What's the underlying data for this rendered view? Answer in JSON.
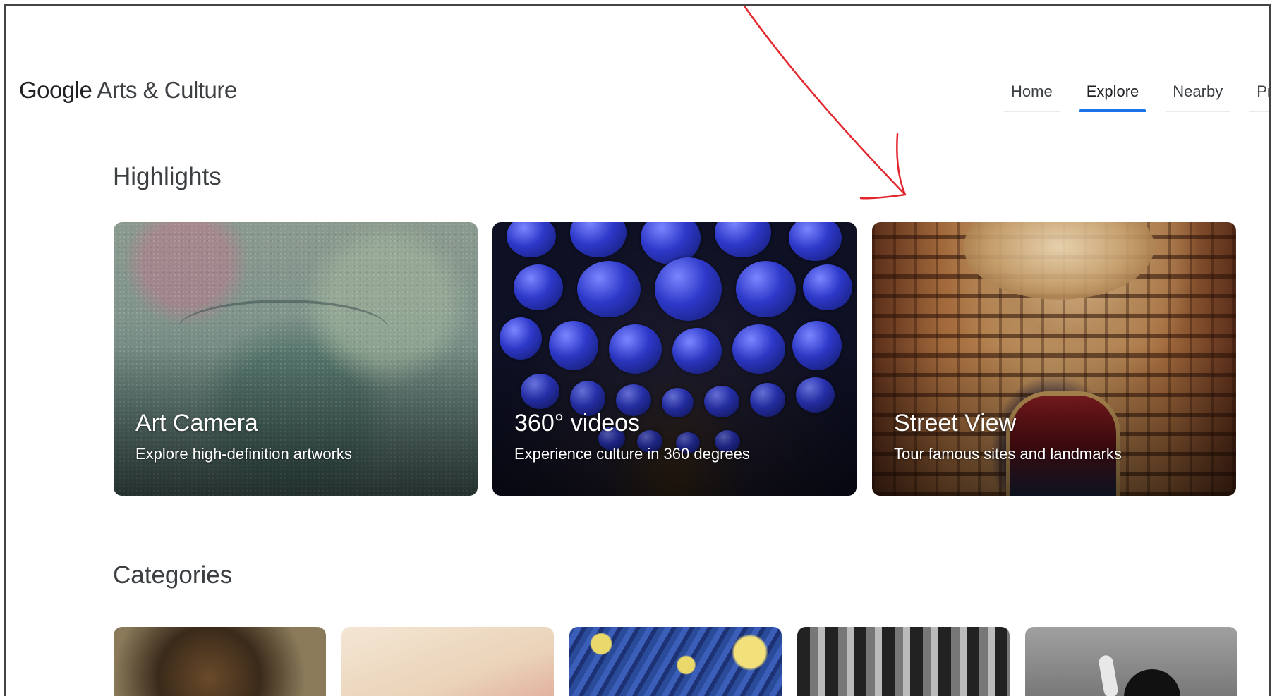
{
  "header": {
    "logo_google": "Google",
    "logo_rest": "Arts & Culture",
    "nav": [
      {
        "label": "Home",
        "active": false
      },
      {
        "label": "Explore",
        "active": true
      },
      {
        "label": "Nearby",
        "active": false
      },
      {
        "label": "Profile",
        "active": false
      }
    ]
  },
  "highlights": {
    "title": "Highlights",
    "cards": [
      {
        "title": "Art Camera",
        "subtitle": "Explore high-definition artworks"
      },
      {
        "title": "360° videos",
        "subtitle": "Experience culture in 360 degrees"
      },
      {
        "title": "Street View",
        "subtitle": "Tour famous sites and landmarks"
      }
    ]
  },
  "categories": {
    "title": "Categories"
  },
  "colors": {
    "accent": "#1a73e8",
    "annotation_arrow": "#e3262d"
  }
}
